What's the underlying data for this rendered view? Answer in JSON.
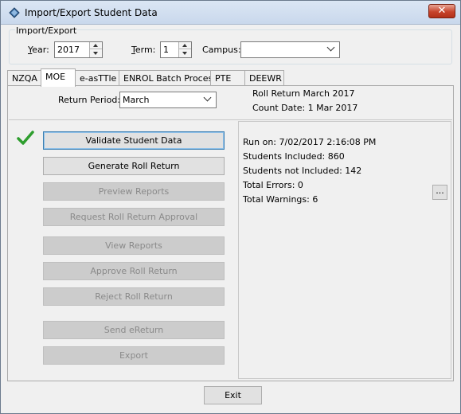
{
  "window": {
    "title": "Import/Export Student Data",
    "close_label": "✕"
  },
  "import_export": {
    "group_label": "Import/Export",
    "year": {
      "label_key": "Y",
      "label_rest": "ear:",
      "value": "2017"
    },
    "term": {
      "label_key": "T",
      "label_rest": "erm:",
      "value": "1"
    },
    "campus": {
      "label": "Campus:",
      "value": ""
    }
  },
  "tabs": [
    {
      "label": "NZQA",
      "active": false
    },
    {
      "label": "MOE",
      "active": true
    },
    {
      "label": "e-asTTle",
      "active": false
    },
    {
      "label": "ENROL Batch Process",
      "active": false
    },
    {
      "label": "PTE",
      "active": false
    },
    {
      "label": "DEEWR",
      "active": false
    }
  ],
  "moe": {
    "return_period_label": "Return Period:",
    "return_period_value": "March",
    "roll_return": "Roll Return March 2017",
    "count_date": "Count Date: 1 Mar 2017",
    "buttons": {
      "validate": "Validate Student Data",
      "generate": "Generate Roll Return",
      "preview": "Preview Reports",
      "request_approval": "Request Roll Return Approval",
      "view_reports": "View Reports",
      "approve": "Approve Roll Return",
      "reject": "Reject Roll Return",
      "send_ereturn": "Send eReturn",
      "export": "Export"
    },
    "results": {
      "run_on": "Run on: 7/02/2017 2:16:08 PM",
      "included": "Students Included: 860",
      "not_included": "Students not Included: 142",
      "errors": "Total Errors: 0",
      "warnings": "Total Warnings: 6"
    },
    "details_button": "..."
  },
  "footer": {
    "exit_label": "Exit"
  },
  "colors": {
    "check": "#2e9e2e",
    "close_red": "#c7432b",
    "focus_blue": "#3c7fb1"
  }
}
